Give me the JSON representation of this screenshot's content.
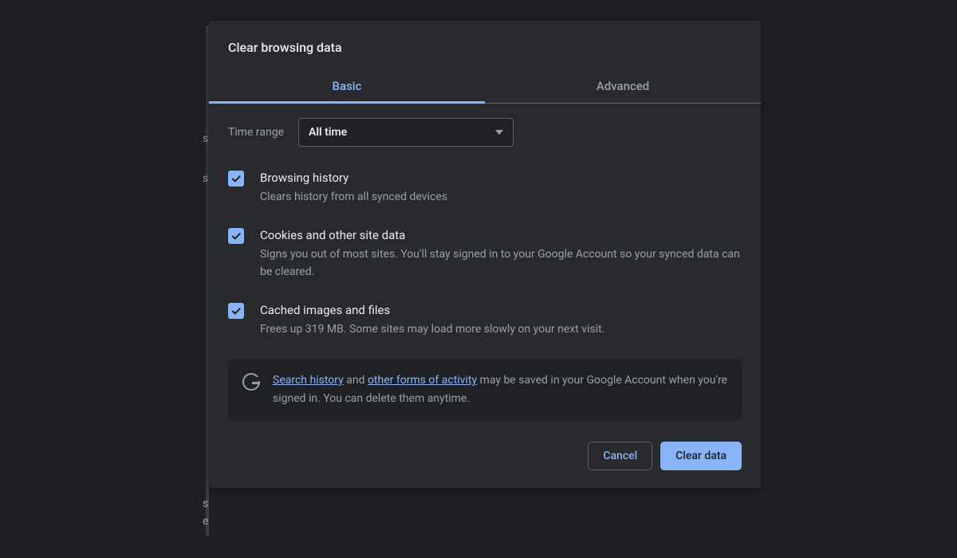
{
  "dialog": {
    "title": "Clear browsing data",
    "tabs": {
      "basic": "Basic",
      "advanced": "Advanced"
    },
    "time_range": {
      "label": "Time range",
      "value": "All time"
    },
    "options": [
      {
        "title": "Browsing history",
        "desc": "Clears history from all synced devices"
      },
      {
        "title": "Cookies and other site data",
        "desc": "Signs you out of most sites. You'll stay signed in to your Google Account so your synced data can be cleared."
      },
      {
        "title": "Cached images and files",
        "desc": "Frees up 319 MB. Some sites may load more slowly on your next visit."
      }
    ],
    "notice": {
      "link1": "Search history",
      "mid1": " and ",
      "link2": "other forms of activity",
      "rest": " may be saved in your Google Account when you're signed in. You can delete them anytime."
    },
    "buttons": {
      "cancel": "Cancel",
      "clear": "Clear data"
    }
  }
}
